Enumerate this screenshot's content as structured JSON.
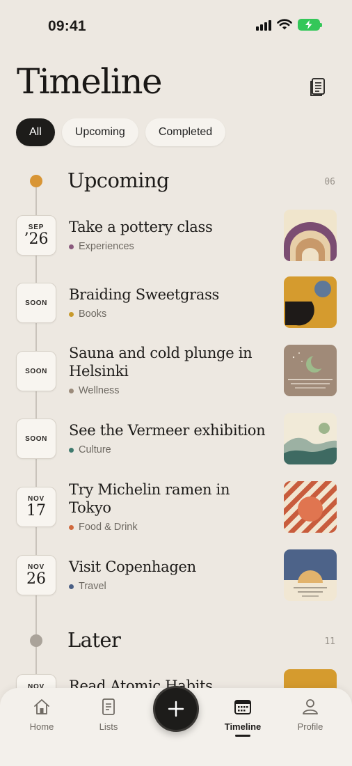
{
  "status_bar": {
    "time": "09:41"
  },
  "header": {
    "title": "Timeline"
  },
  "filters": [
    {
      "label": "All",
      "active": true
    },
    {
      "label": "Upcoming",
      "active": false
    },
    {
      "label": "Completed",
      "active": false
    }
  ],
  "sections": [
    {
      "title": "Upcoming",
      "count": "06",
      "dot_color": "#d89535",
      "items": [
        {
          "date_month": "SEP",
          "date_day": "’26",
          "title": "Take a pottery class",
          "category": "Experiences",
          "category_color": "#8a5a7d",
          "thumb": "rainbow-arches"
        },
        {
          "date_label": "SOON",
          "title": "Braiding Sweetgrass",
          "category": "Books",
          "category_color": "#c89a2c",
          "thumb": "abstract-sun-shape"
        },
        {
          "date_label": "SOON",
          "title": "Sauna and cold plunge in Helsinki",
          "category": "Wellness",
          "category_color": "#9b8a7a",
          "thumb": "moon-night-lake"
        },
        {
          "date_label": "SOON",
          "title": "See the Vermeer exhibition",
          "category": "Culture",
          "category_color": "#3f7a6e",
          "thumb": "green-hills"
        },
        {
          "date_month": "NOV",
          "date_day": "17",
          "title": "Try Michelin ramen in Tokyo",
          "category": "Food & Drink",
          "category_color": "#d06a3e",
          "thumb": "striped-sun"
        },
        {
          "date_month": "NOV",
          "date_day": "26",
          "title": "Visit Copenhagen",
          "category": "Travel",
          "category_color": "#4a5f85",
          "thumb": "sunset-sea"
        }
      ]
    },
    {
      "title": "Later",
      "count": "11",
      "dot_color": "#aaa39a",
      "items": [
        {
          "date_month": "NOV",
          "title": "Read Atomic Habits",
          "thumb": "mustard-block"
        }
      ]
    }
  ],
  "bottom_nav": {
    "items": [
      {
        "label": "Home",
        "icon": "home-icon"
      },
      {
        "label": "Lists",
        "icon": "list-icon"
      },
      {
        "label": "Timeline",
        "icon": "calendar-icon",
        "active": true
      },
      {
        "label": "Profile",
        "icon": "profile-icon"
      }
    ],
    "fab_icon": "plus-icon"
  }
}
